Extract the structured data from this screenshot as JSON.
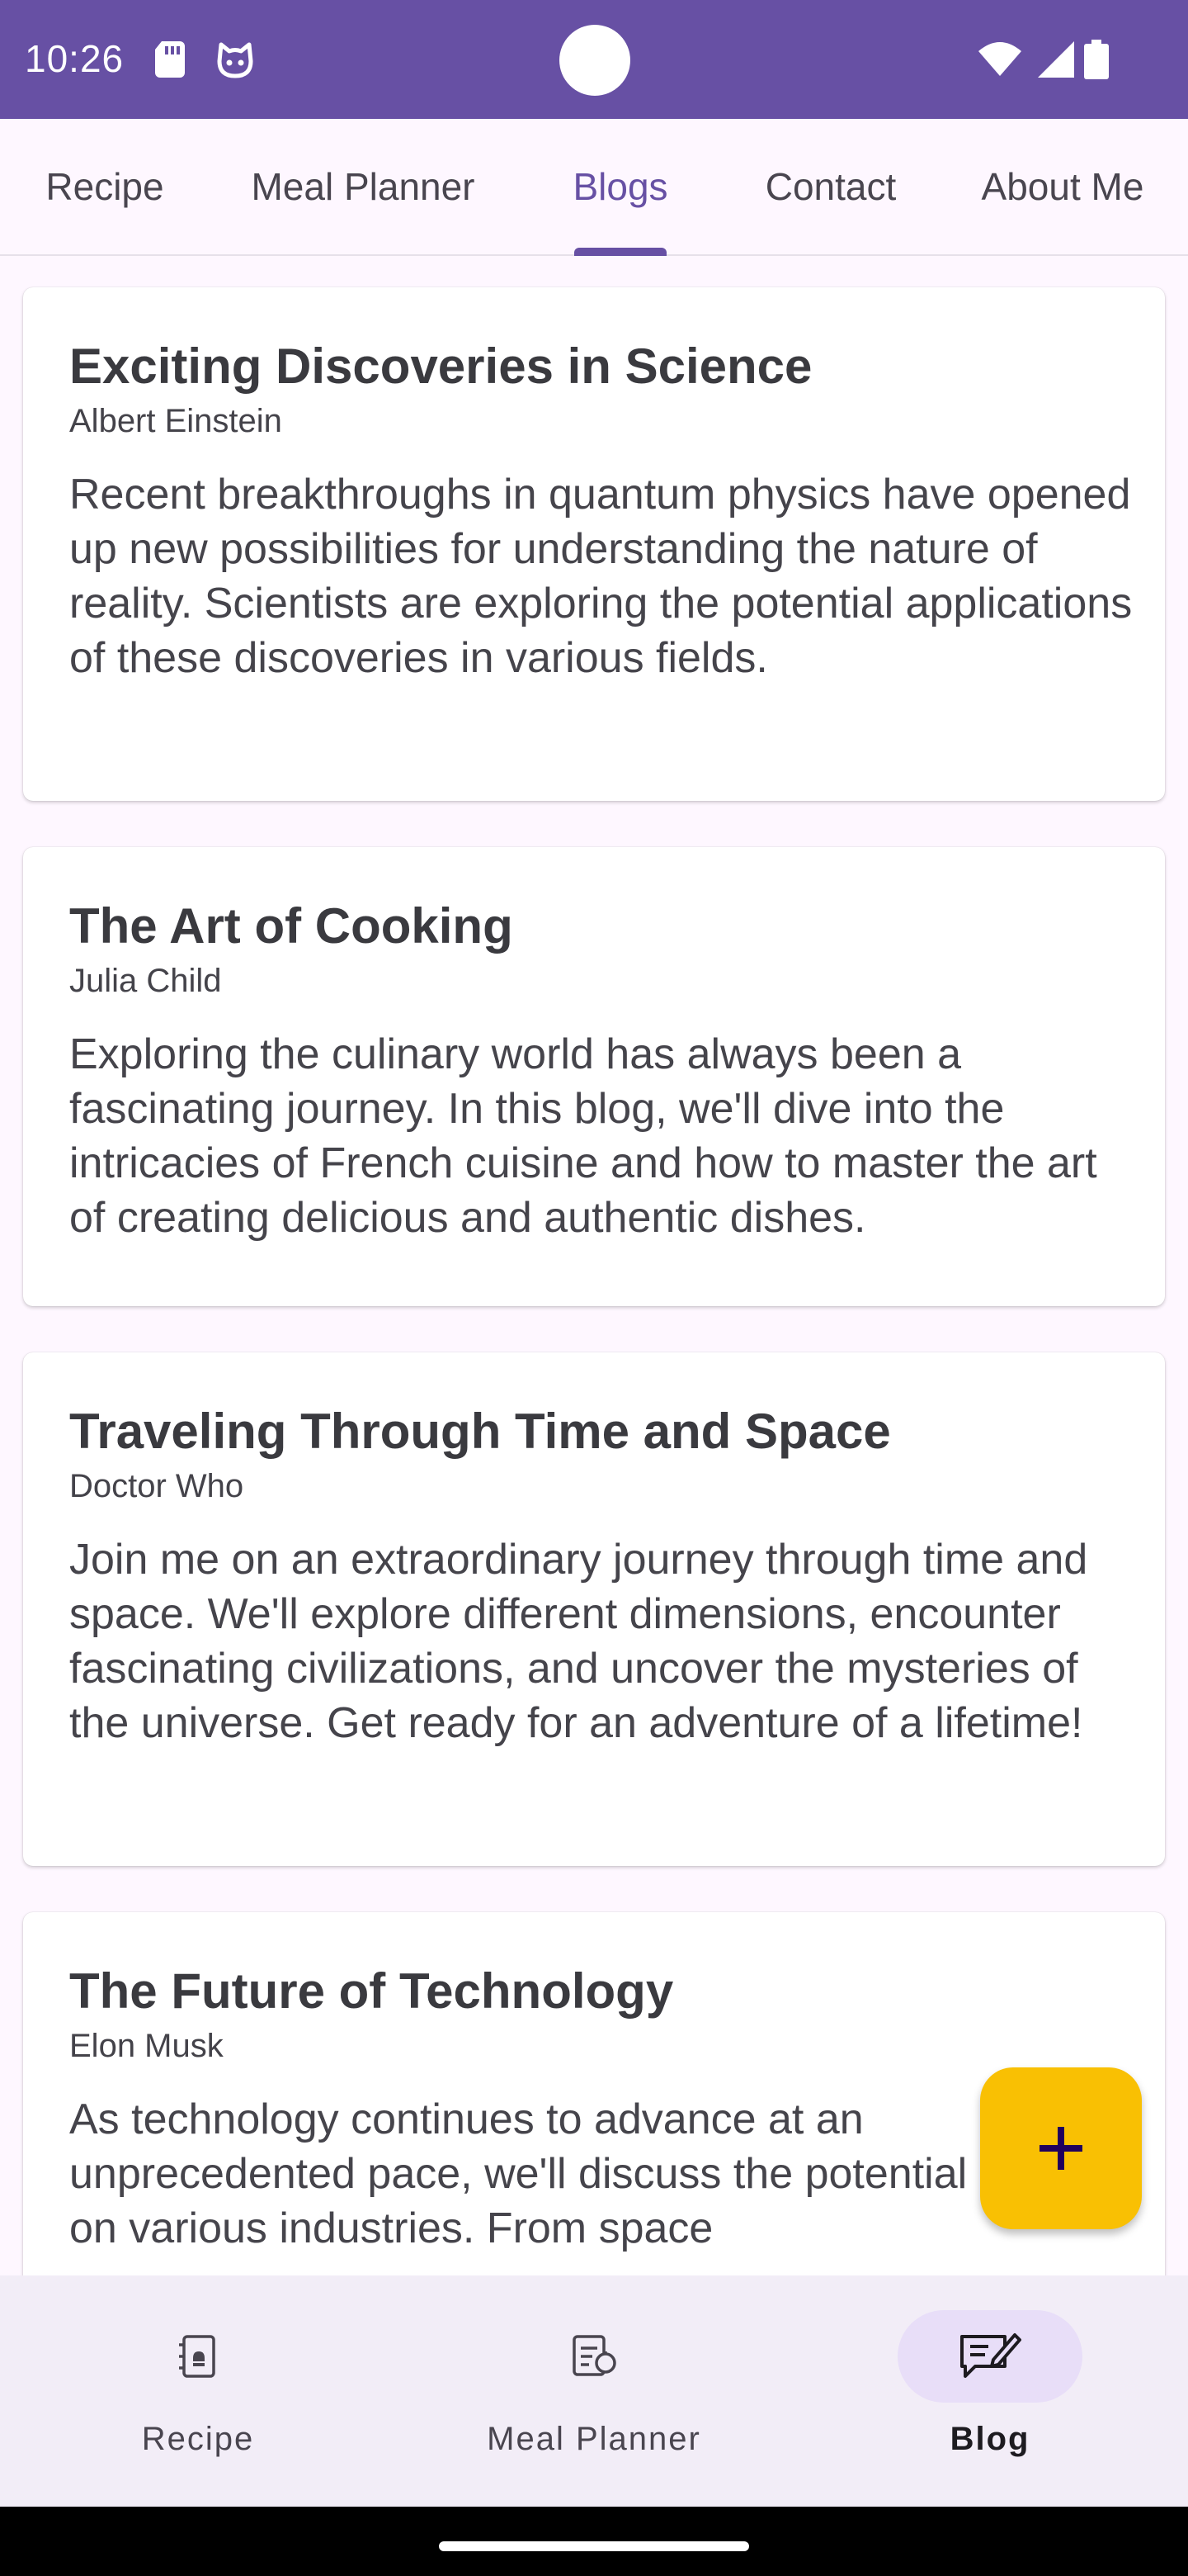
{
  "status_bar": {
    "time": "10:26",
    "icons": [
      "sd-card-icon",
      "cat-face-icon",
      "wifi-icon",
      "cellular-signal-icon",
      "battery-icon"
    ],
    "color": "#6750A4"
  },
  "top_tabs": [
    {
      "label": "Recipe"
    },
    {
      "label": "Meal Planner"
    },
    {
      "label": "Blogs"
    },
    {
      "label": "Contact"
    },
    {
      "label": "About Me"
    }
  ],
  "active_tab": "Blogs",
  "posts": [
    {
      "title": "Exciting Discoveries in Science",
      "author": "Albert Einstein",
      "body": "Recent breakthroughs in quantum physics have opened up new possibilities for understanding the nature of reality. Scientists are exploring the potential applications of these discoveries in various fields."
    },
    {
      "title": "The Art of Cooking",
      "author": "Julia Child",
      "body": "Exploring the culinary world has always been a fascinating journey. In this blog, we'll dive into the intricacies of French cuisine and how to master the art of creating delicious and authentic dishes."
    },
    {
      "title": "Traveling Through Time and Space",
      "author": "Doctor Who",
      "body": "Join me on an extraordinary journey through time and space. We'll explore different dimensions, encounter fascinating civilizations, and uncover the mysteries of the universe. Get ready for an adventure of a lifetime!"
    },
    {
      "title": "The Future of Technology",
      "author": "Elon Musk",
      "body": "As technology continues to advance at an unprecedented pace, we'll discuss the potential impact on various industries. From space"
    }
  ],
  "fab": {
    "icon": "plus-icon",
    "color": "#F9C003"
  },
  "bottom_nav": [
    {
      "label": "Recipe",
      "icon": "recipe-book-icon"
    },
    {
      "label": "Meal Planner",
      "icon": "meal-planner-icon"
    },
    {
      "label": "Blog",
      "icon": "blog-edit-icon"
    }
  ],
  "active_nav": "Blog",
  "colors": {
    "primary": "#6750A4",
    "nav_background": "#F2EDF7",
    "active_pill": "#E8DEF8"
  }
}
